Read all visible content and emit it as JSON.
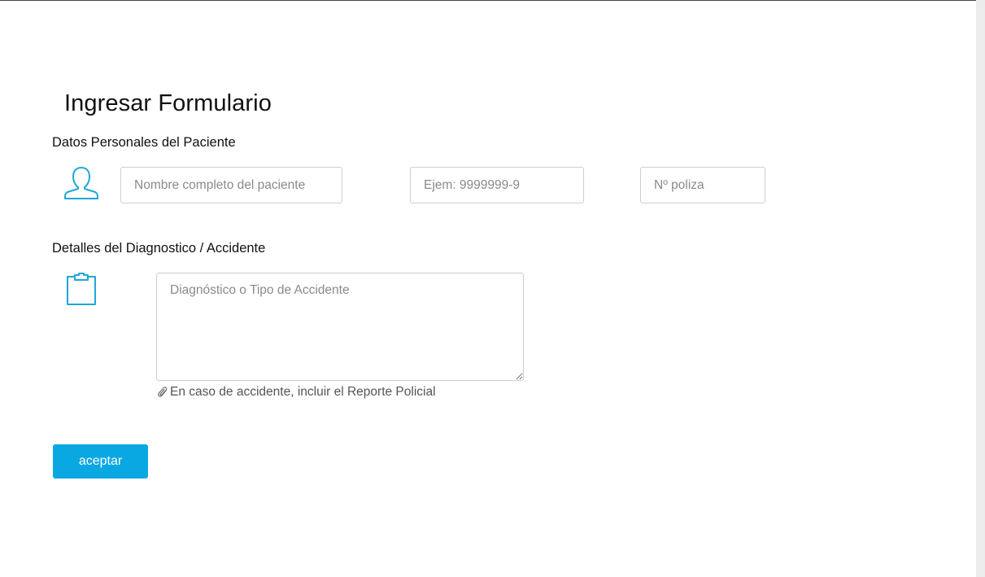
{
  "form": {
    "title": "Ingresar Formulario",
    "personal_section": {
      "title": "Datos Personales del Paciente",
      "icon": "user-icon",
      "fields": {
        "name": {
          "value": "",
          "placeholder": "Nombre completo del paciente"
        },
        "rut": {
          "value": "",
          "placeholder": "Ejem: 9999999-9"
        },
        "policy": {
          "value": "",
          "placeholder": "Nº poliza"
        }
      }
    },
    "diagnosis_section": {
      "title": "Detalles del Diagnostico / Accidente",
      "icon": "clipboard-icon",
      "textarea": {
        "value": "",
        "placeholder": "Diagnóstico o Tipo de Accidente"
      },
      "attachment": {
        "icon": "paperclip-icon",
        "label": "En caso de accidente, incluir el Reporte Policial"
      }
    },
    "submit_label": "aceptar"
  },
  "colors": {
    "accent": "#1fa7d8",
    "button": "#0aa8e3",
    "top_line": "#37474f"
  }
}
